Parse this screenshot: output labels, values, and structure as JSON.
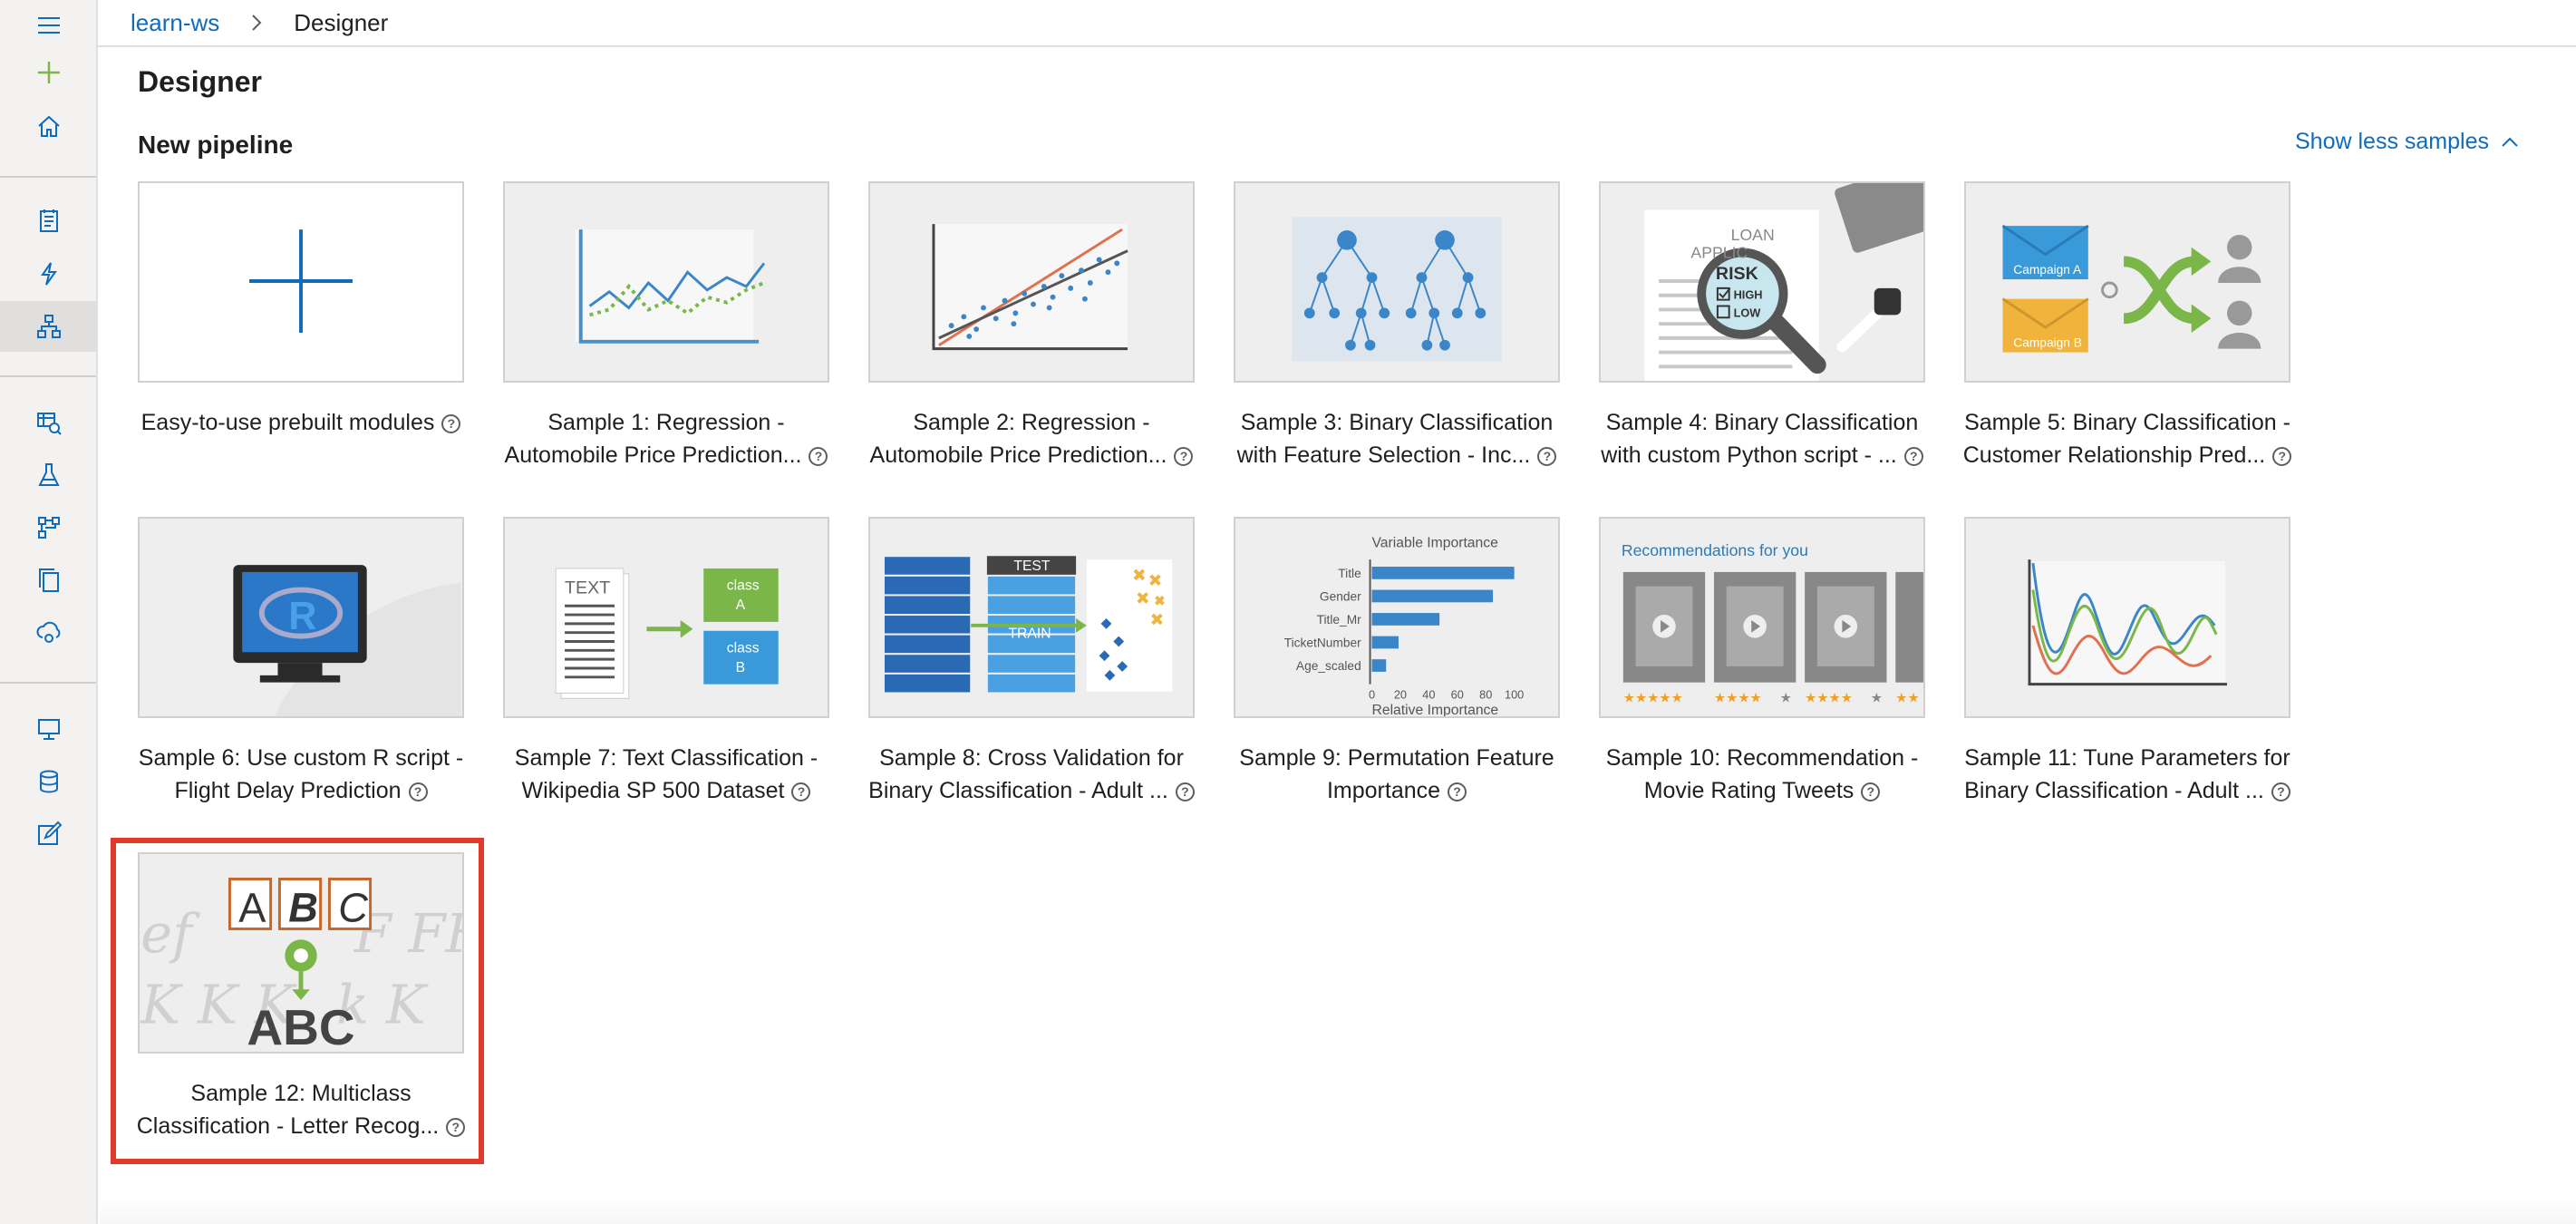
{
  "breadcrumb": {
    "workspace": "learn-ws",
    "current": "Designer"
  },
  "page": {
    "title": "Designer",
    "section_title": "New pipeline",
    "show_less_label": "Show less samples"
  },
  "tiles": [
    {
      "line1": "Easy-to-use prebuilt modules",
      "line2": ""
    },
    {
      "line1": "Sample 1: Regression -",
      "line2": "Automobile Price Prediction..."
    },
    {
      "line1": "Sample 2: Regression -",
      "line2": "Automobile Price Prediction..."
    },
    {
      "line1": "Sample 3: Binary Classification",
      "line2": "with Feature Selection - Inc..."
    },
    {
      "line1": "Sample 4: Binary Classification",
      "line2": "with custom Python script - ..."
    },
    {
      "line1": "Sample 5: Binary Classification -",
      "line2": "Customer Relationship Pred..."
    },
    {
      "line1": "Sample 6: Use custom R script -",
      "line2": "Flight Delay Prediction"
    },
    {
      "line1": "Sample 7: Text Classification -",
      "line2": "Wikipedia SP 500 Dataset"
    },
    {
      "line1": "Sample 8: Cross Validation for",
      "line2": "Binary Classification - Adult ..."
    },
    {
      "line1": "Sample 9: Permutation Feature",
      "line2": "Importance"
    },
    {
      "line1": "Sample 10: Recommendation -",
      "line2": "Movie Rating Tweets"
    },
    {
      "line1": "Sample 11: Tune Parameters for",
      "line2": "Binary Classification - Adult ..."
    },
    {
      "line1": "Sample 12: Multiclass",
      "line2": "Classification - Letter Recog..."
    }
  ],
  "thumb_text": {
    "loan": "LOAN",
    "applic": "APPLIC",
    "risk": "RISK",
    "high": "HIGH",
    "low": "LOW",
    "campaign_a": "Campaign A",
    "campaign_b": "Campaign B",
    "r_letter": "R",
    "text_doc": "TEXT",
    "class": "class",
    "class_a": "A",
    "class_b": "B",
    "test": "TEST",
    "train": "TRAIN",
    "variable_importance": "Variable Importance",
    "relative_importance": "Relative Importance",
    "features": [
      "Title",
      "Gender",
      "Title_Mr",
      "TicketNumber",
      "Age_scaled"
    ],
    "importance_ticks": [
      "0",
      "20",
      "40",
      "60",
      "80",
      "100"
    ],
    "recommendations": "Recommendations for you",
    "abc_upper": "ABC",
    "letter_a": "A",
    "letter_b": "B",
    "letter_c": "C"
  },
  "help_glyph": "?",
  "icons": [
    "menu-icon",
    "plus-icon",
    "home-icon",
    "notebook-icon",
    "automl-icon",
    "designer-icon",
    "datasets-icon",
    "experiments-icon",
    "pipelines-icon",
    "models-icon",
    "endpoints-icon",
    "compute-icon",
    "datastores-icon",
    "labeling-icon",
    "chevron-right-icon",
    "chevron-up-icon",
    "help-icon"
  ],
  "colors": {
    "accent": "#0f6cbd",
    "highlight": "#e03a2a",
    "green": "#7ab648",
    "orange": "#f4b400"
  }
}
